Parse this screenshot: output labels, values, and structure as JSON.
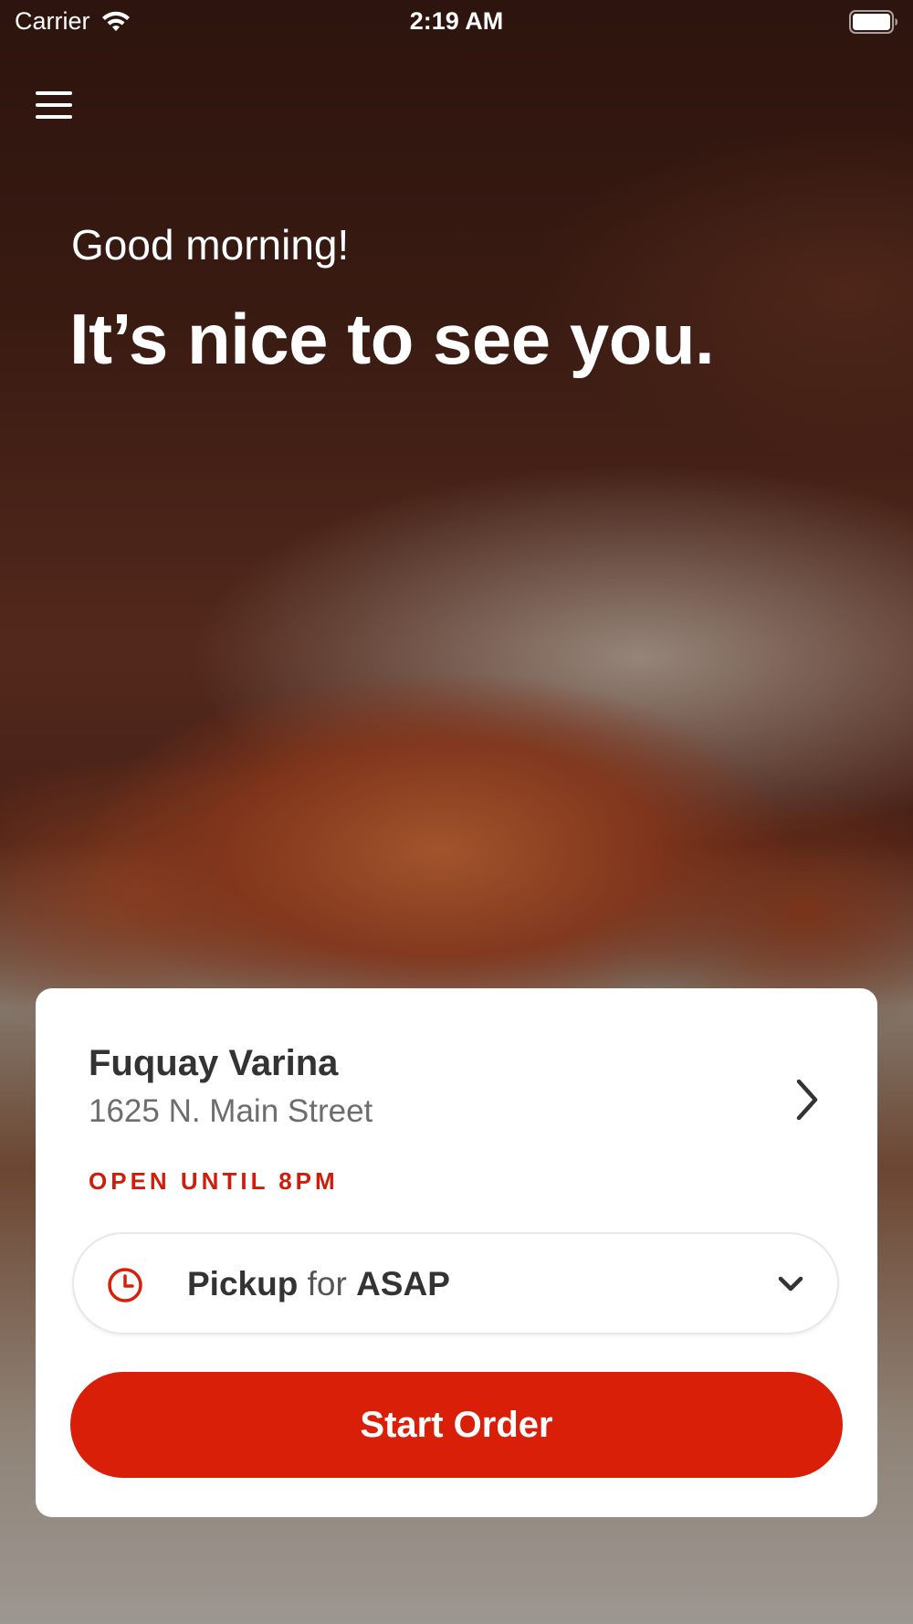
{
  "status_bar": {
    "carrier": "Carrier",
    "time": "2:19 AM"
  },
  "hero": {
    "greeting": "Good morning!",
    "headline": "It’s nice to see you."
  },
  "location_card": {
    "store_name": "Fuquay Varina",
    "address": "1625 N. Main Street",
    "hours": "OPEN UNTIL 8PM",
    "order_mode": {
      "mode": "Pickup",
      "connector": "for",
      "time": "ASAP"
    },
    "start_button_label": "Start Order"
  },
  "colors": {
    "accent": "#d91f08",
    "hours_text": "#d01c0a",
    "card_background": "#ffffff"
  },
  "icons": [
    "wifi-icon",
    "battery-icon",
    "menu-icon",
    "chevron-right-icon",
    "clock-icon",
    "chevron-down-icon"
  ]
}
